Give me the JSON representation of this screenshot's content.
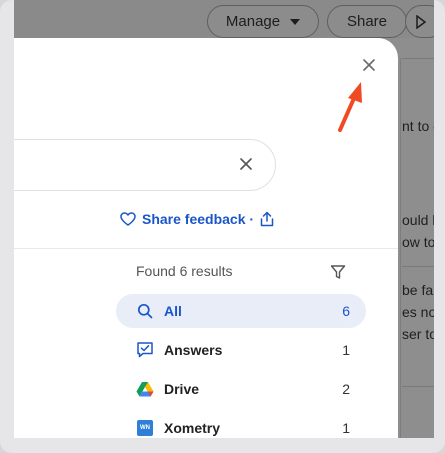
{
  "background": {
    "toolbar": {
      "manage_label": "Manage",
      "share_label": "Share"
    },
    "snippets": [
      "nt to c",
      "ould b",
      "ow to",
      "be fa",
      "es no",
      "ser to"
    ]
  },
  "feedback": {
    "label": "Share feedback ·"
  },
  "results": {
    "summary": "Found 6 results",
    "items": [
      {
        "label": "All",
        "count": "6",
        "icon": "search-icon",
        "active": true
      },
      {
        "label": "Answers",
        "count": "1",
        "icon": "chat-check-icon",
        "active": false
      },
      {
        "label": "Drive",
        "count": "2",
        "icon": "google-drive-icon",
        "active": false
      },
      {
        "label": "Xometry",
        "count": "1",
        "icon": "xometry-icon",
        "active": false
      }
    ]
  },
  "xometry_badge": "WN",
  "colors": {
    "accent": "#1a56c9",
    "annotation_arrow": "#f04a24",
    "active_row_bg": "#e8edf8"
  }
}
